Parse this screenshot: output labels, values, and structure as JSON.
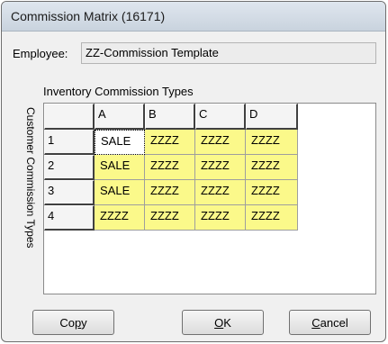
{
  "window": {
    "title": "Commission Matrix (16171)"
  },
  "employee": {
    "label": "Employee:",
    "value": "ZZ-Commission Template"
  },
  "matrix": {
    "column_group_label": "Inventory Commission Types",
    "row_group_label": "Customer Commission Types",
    "columns": [
      "A",
      "B",
      "C",
      "D"
    ],
    "rows": [
      {
        "label": "1",
        "cells": [
          "SALE",
          "ZZZZ",
          "ZZZZ",
          "ZZZZ"
        ]
      },
      {
        "label": "2",
        "cells": [
          "SALE",
          "ZZZZ",
          "ZZZZ",
          "ZZZZ"
        ]
      },
      {
        "label": "3",
        "cells": [
          "SALE",
          "ZZZZ",
          "ZZZZ",
          "ZZZZ"
        ]
      },
      {
        "label": "4",
        "cells": [
          "ZZZZ",
          "ZZZZ",
          "ZZZZ",
          "ZZZZ"
        ]
      }
    ],
    "cell_color": "#fbf98a",
    "selected_cell_color": "#ffffff"
  },
  "buttons": {
    "copy": {
      "pre": "Co",
      "mnemonic": "p",
      "post": "y"
    },
    "ok": {
      "pre": "",
      "mnemonic": "O",
      "post": "K"
    },
    "cancel": {
      "pre": "",
      "mnemonic": "C",
      "post": "ancel"
    }
  }
}
